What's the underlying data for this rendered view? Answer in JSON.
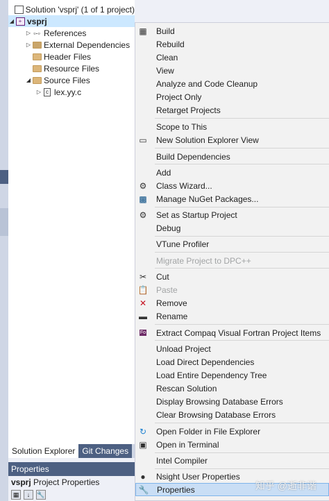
{
  "explorer": {
    "solution_label": "Solution 'vsprj' (1 of 1 project)",
    "project_label": "vsprj",
    "items": [
      {
        "label": "References"
      },
      {
        "label": "External Dependencies"
      },
      {
        "label": "Header Files"
      },
      {
        "label": "Resource Files"
      },
      {
        "label": "Source Files"
      },
      {
        "label": "lex.yy.c"
      }
    ],
    "tabs": [
      "Solution Explorer",
      "Git Changes"
    ]
  },
  "properties": {
    "title": "Properties",
    "object_name": "vsprj",
    "object_type": "Project Properties"
  },
  "menu": {
    "items": [
      {
        "label": "Build",
        "icon": "build-icon"
      },
      {
        "label": "Rebuild"
      },
      {
        "label": "Clean"
      },
      {
        "label": "View"
      },
      {
        "label": "Analyze and Code Cleanup"
      },
      {
        "label": "Project Only"
      },
      {
        "label": "Retarget Projects"
      },
      {
        "label": "Scope to This"
      },
      {
        "label": "New Solution Explorer View",
        "icon": "new-view-icon"
      },
      {
        "label": "Build Dependencies"
      },
      {
        "label": "Add"
      },
      {
        "label": "Class Wizard...",
        "icon": "class-wizard-icon"
      },
      {
        "label": "Manage NuGet Packages...",
        "icon": "nuget-icon"
      },
      {
        "label": "Set as Startup Project",
        "icon": "gear-icon"
      },
      {
        "label": "Debug"
      },
      {
        "label": "VTune Profiler"
      },
      {
        "label": "Migrate Project to DPC++",
        "disabled": true
      },
      {
        "label": "Cut",
        "icon": "scissors-icon"
      },
      {
        "label": "Paste",
        "icon": "paste-icon",
        "disabled": true
      },
      {
        "label": "Remove",
        "icon": "remove-icon"
      },
      {
        "label": "Rename",
        "icon": "rename-icon"
      },
      {
        "label": "Extract Compaq Visual Fortran Project Items",
        "icon": "fortran-icon"
      },
      {
        "label": "Unload Project"
      },
      {
        "label": "Load Direct Dependencies"
      },
      {
        "label": "Load Entire Dependency Tree"
      },
      {
        "label": "Rescan Solution"
      },
      {
        "label": "Display Browsing Database Errors"
      },
      {
        "label": "Clear Browsing Database Errors"
      },
      {
        "label": "Open Folder in File Explorer",
        "icon": "open-folder-icon"
      },
      {
        "label": "Open in Terminal",
        "icon": "terminal-icon"
      },
      {
        "label": "Intel Compiler"
      },
      {
        "label": "Nsight User Properties",
        "icon": "nsight-icon"
      },
      {
        "label": "Properties",
        "icon": "wrench-icon"
      }
    ]
  },
  "watermark": "知乎 @逝非谐",
  "colors": {
    "selection": "#cce8ff",
    "hover": "#c9def5",
    "panel_title": "#4d6082",
    "menu_bg": "#f2f2f2"
  }
}
